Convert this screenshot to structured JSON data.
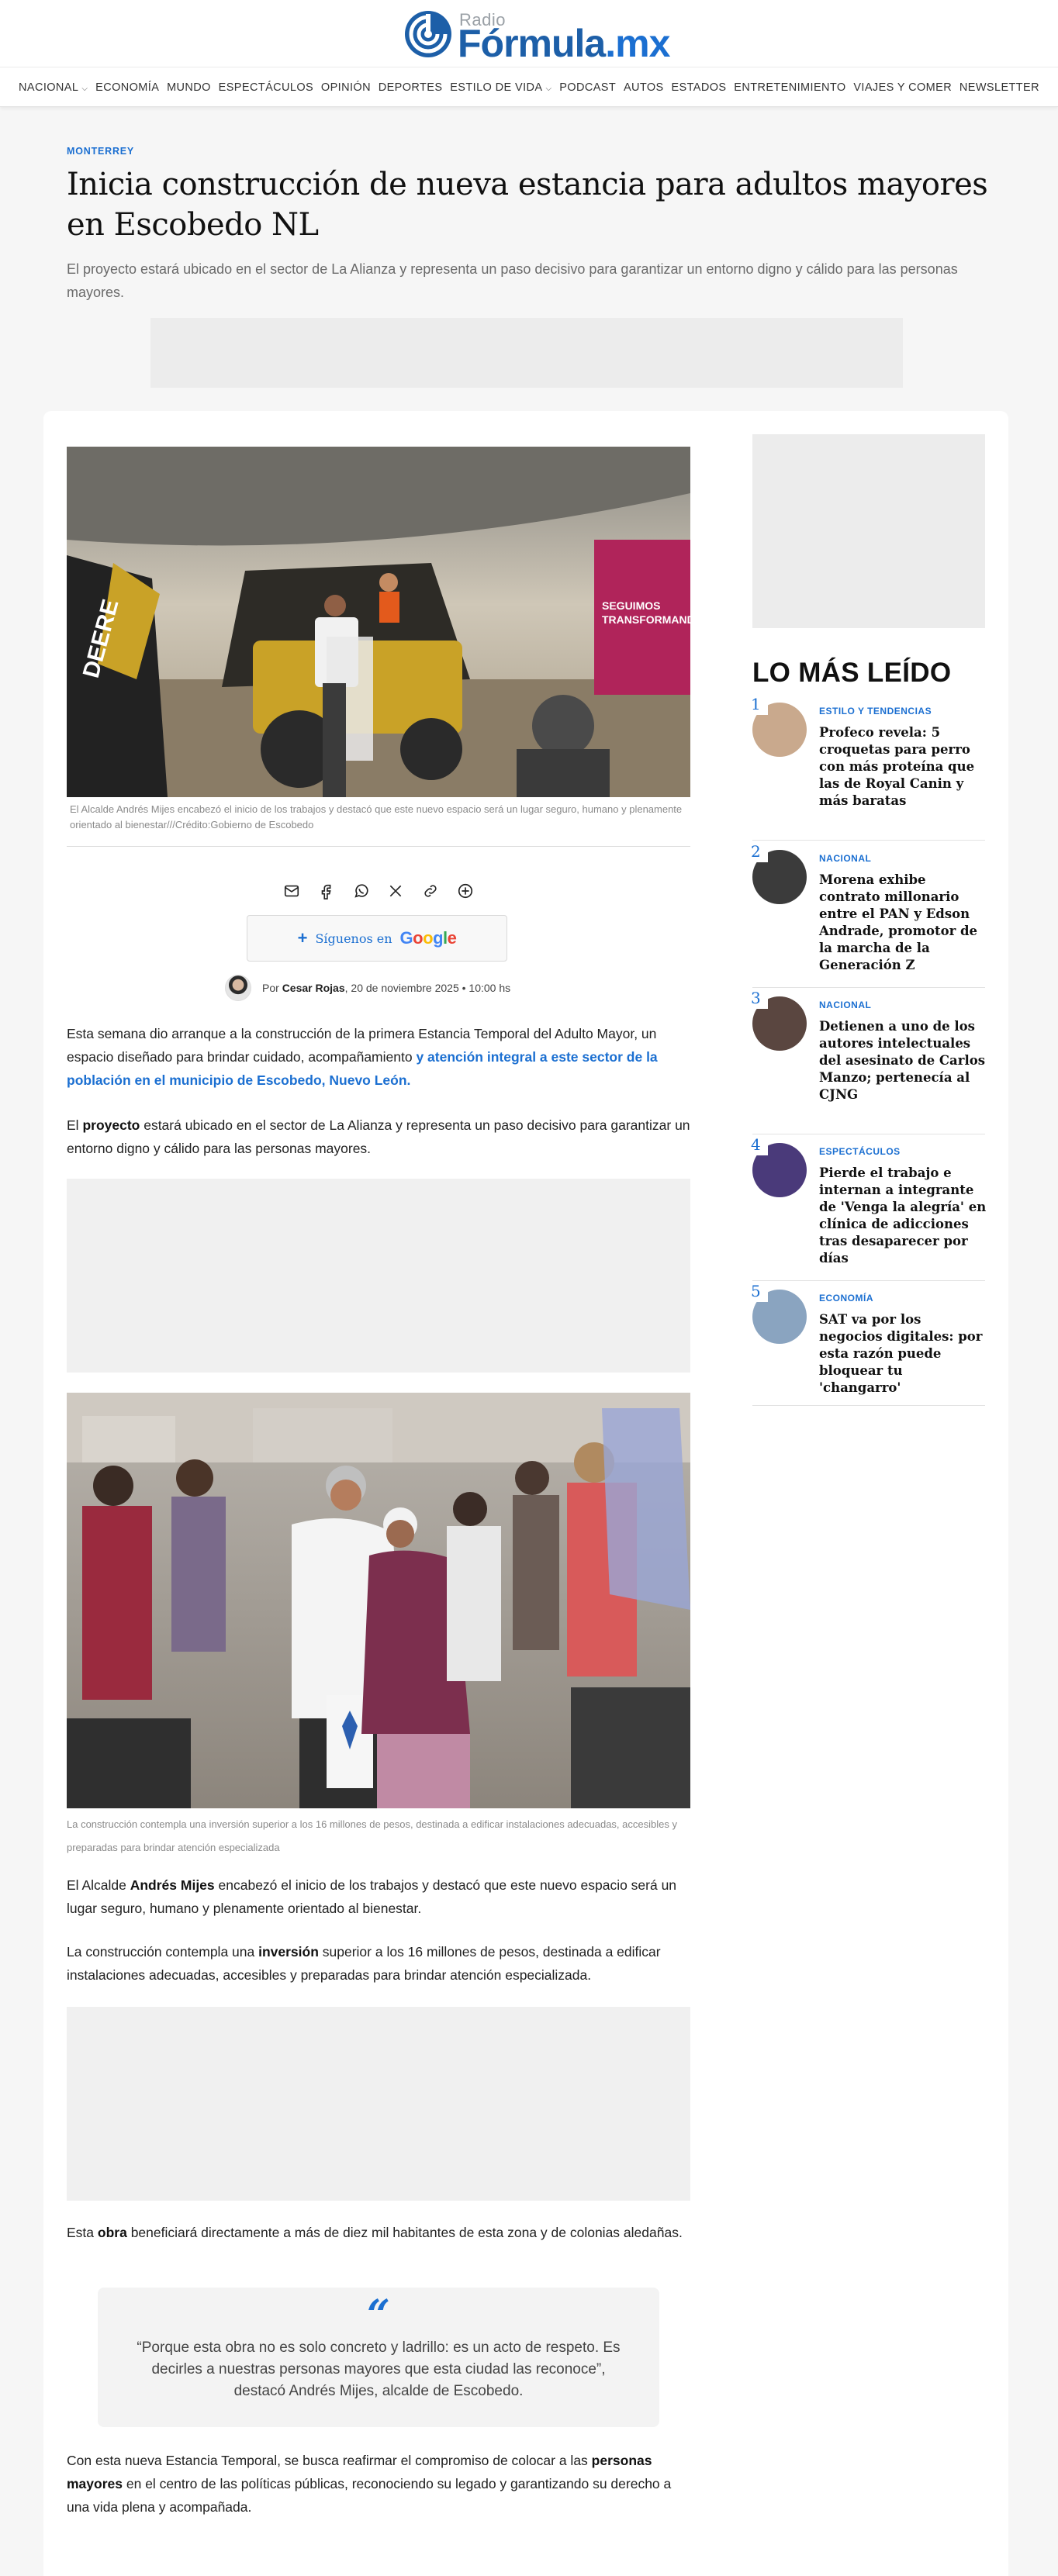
{
  "brand": {
    "radio": "Radio",
    "formula": "Fórmula",
    "mx": ".mx"
  },
  "nav": [
    {
      "label": "NACIONAL",
      "dropdown": true
    },
    {
      "label": "ECONOMÍA"
    },
    {
      "label": "MUNDO"
    },
    {
      "label": "ESPECTÁCULOS"
    },
    {
      "label": "OPINIÓN"
    },
    {
      "label": "DEPORTES"
    },
    {
      "label": "ESTILO DE VIDA",
      "dropdown": true
    },
    {
      "label": "PODCAST"
    },
    {
      "label": "AUTOS"
    },
    {
      "label": "ESTADOS"
    },
    {
      "label": "ENTRETENIMIENTO"
    },
    {
      "label": "VIAJES Y COMER"
    },
    {
      "label": "NEWSLETTER"
    }
  ],
  "article": {
    "kicker": "MONTERREY",
    "title": "Inicia construcción de nueva estancia para adultos mayores en Escobedo NL",
    "dek": "El proyecto estará ubicado en el sector de La Alianza y representa un paso decisivo para garantizar un entorno digno y cálido para las personas mayores.",
    "caption1": "El Alcalde Andrés Mijes encabezó el inicio de los trabajos y destacó que este nuevo espacio será un lugar seguro, humano y plenamente orientado al bienestar///Crédito:Gobierno de Escobedo",
    "follow_label": "Síguenos en",
    "google_label": "Google",
    "byline_prefix": "Por",
    "author": "Cesar Rojas",
    "date": ", 20 de noviembre 2025 • 10:00 hs",
    "p1_a": "Esta semana dio arranque a la construcción de la primera Estancia Temporal del Adulto Mayor, un espacio diseñado para brindar cuidado, acompañamiento ",
    "p1_link": "y atención integral a este sector de la población en el municipio de Escobedo, Nuevo León.",
    "p2_a": "El ",
    "p2_b": "proyecto",
    "p2_c": " estará ubicado en el sector de La Alianza y representa un paso decisivo para garantizar un entorno digno y cálido para las personas mayores.",
    "caption2": "La construcción contempla una inversión superior a los 16 millones de pesos, destinada a edificar instalaciones adecuadas, accesibles y preparadas para brindar atención especializada",
    "p3_a": "El Alcalde ",
    "p3_b": "Andrés Mijes",
    "p3_c": " encabezó el inicio de los trabajos y destacó que este nuevo espacio será un lugar seguro, humano y plenamente orientado al bienestar.",
    "p4_a": "La construcción contempla una ",
    "p4_b": "inversión",
    "p4_c": " superior a los 16 millones de pesos, destinada a edificar instalaciones adecuadas, accesibles y preparadas para brindar atención especializada.",
    "p5_a": "Esta ",
    "p5_b": "obra",
    "p5_c": " beneficiará directamente a más de diez mil habitantes de esta zona y de colonias aledañas.",
    "quote_mark": "“",
    "quote": "“Porque esta obra no es solo concreto y ladrillo: es un acto de respeto. Es decirles a nuestras personas mayores que esta ciudad las reconoce”, destacó Andrés Mijes, alcalde de Escobedo.",
    "p6_a": "Con esta nueva Estancia Temporal, se busca reafirmar el compromiso de colocar a las ",
    "p6_b": "personas mayores",
    "p6_c": " en el centro de las políticas públicas, reconociendo su legado y garantizando su derecho a una vida plena y acompañada."
  },
  "photo1": {
    "banner_line1": "SEGUIMOS",
    "banner_line2": "TRANSFORMANDO",
    "brand_text": "DEERE"
  },
  "sidebar": {
    "title": "LO MÁS LEÍDO",
    "items": [
      {
        "num": "1",
        "category": "ESTILO Y TENDENCIAS",
        "title": "Profeco revela: 5 croquetas para perro con más proteína que las de Royal Canin y más baratas",
        "thumb_color": "#c9a98d"
      },
      {
        "num": "2",
        "category": "NACIONAL",
        "title": "Morena exhibe contrato millonario entre el PAN y Edson Andrade, promotor de la marcha de la Generación Z",
        "thumb_color": "#3b3b3b"
      },
      {
        "num": "3",
        "category": "NACIONAL",
        "title": "Detienen a uno de los autores intelectuales del asesinato de Carlos Manzo; pertenecía al CJNG",
        "thumb_color": "#5a4640"
      },
      {
        "num": "4",
        "category": "ESPECTÁCULOS",
        "title": "Pierde el trabajo e internan a integrante de 'Venga la alegría' en clínica de adicciones tras desaparecer por días",
        "thumb_color": "#4a3a7a"
      },
      {
        "num": "5",
        "category": "ECONOMÍA",
        "title": "SAT va por los negocios digitales: por esta razón puede bloquear tu 'changarro'",
        "thumb_color": "#8aa4c0"
      }
    ]
  },
  "colors": {
    "accent": "#1b6fd1",
    "brand": "#1d5fa8"
  }
}
